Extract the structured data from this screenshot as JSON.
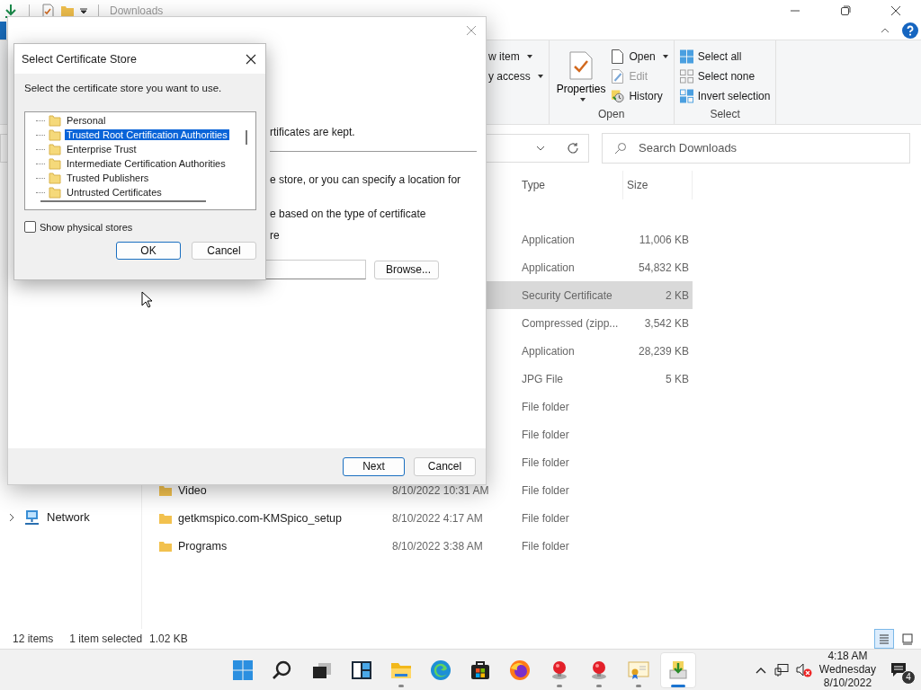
{
  "explorer": {
    "title": "Downloads",
    "ribbon": {
      "new_items": [
        {
          "label": "w item",
          "dropdown": true
        },
        {
          "label": "y access",
          "dropdown": true
        }
      ],
      "properties": "Properties",
      "open_items": [
        {
          "kind": "open",
          "label": "Open",
          "dropdown": true,
          "disabled": false
        },
        {
          "kind": "edit",
          "label": "Edit",
          "dropdown": false,
          "disabled": true
        },
        {
          "kind": "history",
          "label": "History",
          "dropdown": false,
          "disabled": false
        }
      ],
      "open_label": "Open",
      "select_items": [
        {
          "kind": "all",
          "label": "Select all"
        },
        {
          "kind": "none",
          "label": "Select none"
        },
        {
          "kind": "invert",
          "label": "Invert selection"
        }
      ],
      "select_label": "Select"
    },
    "search": {
      "placeholder": "Search Downloads"
    },
    "columns": [
      "Type",
      "Size"
    ],
    "rows": [
      {
        "type": "Application",
        "size": "11,006 KB",
        "selected": false
      },
      {
        "type": "Application",
        "size": "54,832 KB",
        "selected": false
      },
      {
        "type": "Security Certificate",
        "size": "2 KB",
        "selected": true
      },
      {
        "type": "Compressed (zipp...",
        "size": "3,542 KB",
        "selected": false
      },
      {
        "type": "Application",
        "size": "28,239 KB",
        "selected": false
      },
      {
        "type": "JPG File",
        "size": "5 KB",
        "selected": false
      },
      {
        "type": "File folder",
        "selected": false
      },
      {
        "type": "File folder",
        "selected": false
      },
      {
        "type": "File folder",
        "selected": false
      },
      {
        "name": "Video",
        "date": "8/10/2022 10:31 AM",
        "type": "File folder",
        "selected": false
      },
      {
        "name": "getkmspico.com-KMSpico_setup",
        "date": "8/10/2022 4:17 AM",
        "type": "File folder",
        "selected": false
      },
      {
        "name": "Programs",
        "date": "8/10/2022 3:38 AM",
        "type": "File folder",
        "selected": false
      }
    ],
    "sidebar": [
      {
        "label": "Network",
        "expanded": false
      }
    ],
    "status": {
      "count": "12 items",
      "selection": "1 item selected",
      "selection_size": "1.02 KB"
    },
    "views": [
      {
        "kind": "details",
        "selected": true
      },
      {
        "kind": "tiles",
        "selected": false
      }
    ]
  },
  "wizard": {
    "intro": "rtificates are kept.",
    "lines": [
      "e store, or you can specify a location for",
      "e based on the type of certificate",
      "re"
    ],
    "browse": "Browse...",
    "next": "Next",
    "cancel": "Cancel"
  },
  "store_dialog": {
    "title": "Select Certificate Store",
    "prompt": "Select the certificate store you want to use.",
    "stores": [
      {
        "label": "Personal",
        "selected": false
      },
      {
        "label": "Trusted Root Certification Authorities",
        "selected": true
      },
      {
        "label": "Enterprise Trust",
        "selected": false
      },
      {
        "label": "Intermediate Certification Authorities",
        "selected": false
      },
      {
        "label": "Trusted Publishers",
        "selected": false
      },
      {
        "label": "Untrusted Certificates",
        "selected": false
      }
    ],
    "show_physical": {
      "label": "Show physical stores",
      "checked": false
    },
    "ok": "OK",
    "cancel": "Cancel"
  },
  "taskbar": {
    "apps": [
      {
        "kind": "start",
        "running": false,
        "active": false
      },
      {
        "kind": "search",
        "running": false,
        "active": false
      },
      {
        "kind": "taskview",
        "running": false,
        "active": false
      },
      {
        "kind": "widgets",
        "running": false,
        "active": false
      },
      {
        "kind": "explorer",
        "running": true,
        "active": false
      },
      {
        "kind": "edge",
        "running": false,
        "active": false
      },
      {
        "kind": "store",
        "running": false,
        "active": false
      },
      {
        "kind": "firefox",
        "running": false,
        "active": false
      },
      {
        "kind": "redball",
        "running": true,
        "active": false
      },
      {
        "kind": "redball",
        "running": true,
        "active": false
      },
      {
        "kind": "certificate",
        "running": true,
        "active": false
      },
      {
        "kind": "installer",
        "running": true,
        "active": true
      }
    ],
    "time": "4:18 AM",
    "day": "Wednesday",
    "date": "8/10/2022",
    "notifications": "4"
  }
}
